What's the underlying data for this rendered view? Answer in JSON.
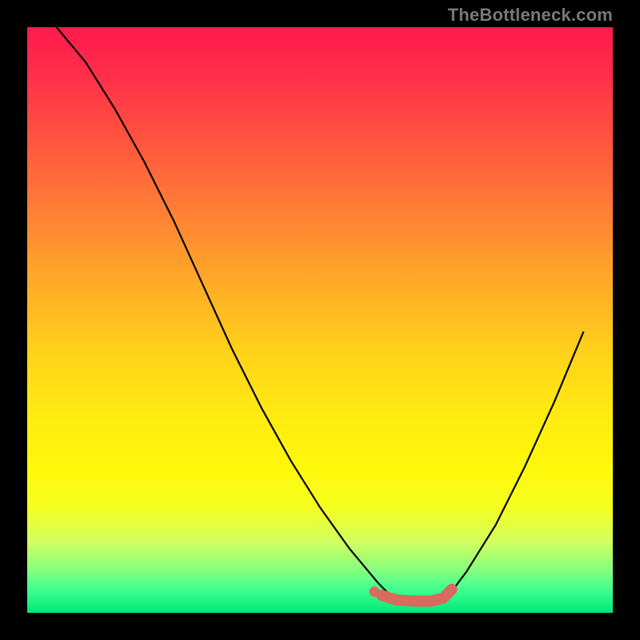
{
  "watermark": "TheBottleneck.com",
  "chart_data": {
    "type": "line",
    "title": "",
    "xlabel": "",
    "ylabel": "",
    "xlim": [
      0,
      100
    ],
    "ylim": [
      0,
      100
    ],
    "series": [
      {
        "name": "curve",
        "x": [
          5,
          10,
          15,
          20,
          25,
          30,
          35,
          40,
          45,
          50,
          55,
          60,
          62,
          65,
          68,
          70,
          72,
          75,
          80,
          85,
          90,
          95
        ],
        "y": [
          100,
          94,
          86,
          77,
          67,
          56,
          45,
          35,
          26,
          18,
          11,
          5,
          3,
          2,
          2,
          2,
          3,
          7,
          15,
          25,
          36,
          48
        ]
      }
    ],
    "markers": {
      "color": "#d96a5e",
      "points_x": [
        60.5,
        63,
        66,
        69,
        71,
        72.5
      ],
      "points_y": [
        3.0,
        2.2,
        2.0,
        2.0,
        2.5,
        4.0
      ]
    },
    "colors": {
      "curve": "#000000",
      "marker": "#d96a5e"
    }
  }
}
